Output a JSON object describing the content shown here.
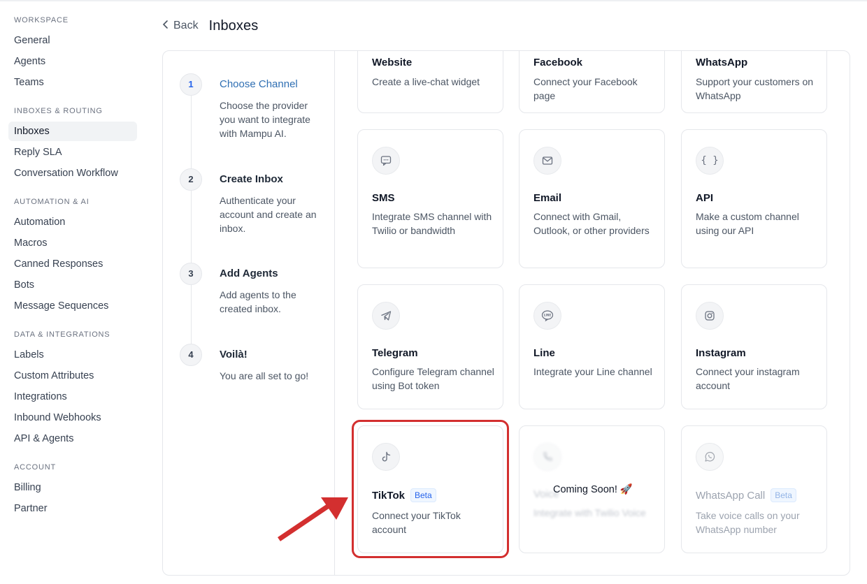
{
  "sidebar": {
    "sections": [
      {
        "title": "WORKSPACE",
        "items": [
          "General",
          "Agents",
          "Teams"
        ]
      },
      {
        "title": "INBOXES & ROUTING",
        "items": [
          "Inboxes",
          "Reply SLA",
          "Conversation Workflow"
        ]
      },
      {
        "title": "AUTOMATION & AI",
        "items": [
          "Automation",
          "Macros",
          "Canned Responses",
          "Bots",
          "Message Sequences"
        ]
      },
      {
        "title": "DATA & INTEGRATIONS",
        "items": [
          "Labels",
          "Custom Attributes",
          "Integrations",
          "Inbound Webhooks",
          "API & Agents"
        ]
      },
      {
        "title": "ACCOUNT",
        "items": [
          "Billing",
          "Partner"
        ]
      }
    ],
    "active": "Inboxes"
  },
  "header": {
    "back_label": "Back",
    "title": "Inboxes"
  },
  "steps": [
    {
      "num": "1",
      "title": "Choose Channel",
      "desc": "Choose the provider you want to integrate with Mampu AI."
    },
    {
      "num": "2",
      "title": "Create Inbox",
      "desc": "Authenticate your account and create an inbox."
    },
    {
      "num": "3",
      "title": "Add Agents",
      "desc": "Add agents to the created inbox."
    },
    {
      "num": "4",
      "title": "Voilà!",
      "desc": "You are all set to go!"
    }
  ],
  "channels": {
    "website": {
      "name": "Website",
      "desc": "Create a live-chat widget",
      "icon": "globe-icon"
    },
    "facebook": {
      "name": "Facebook",
      "desc": "Connect your Facebook page",
      "icon": "facebook-icon"
    },
    "whatsapp": {
      "name": "WhatsApp",
      "desc": "Support your customers on WhatsApp",
      "icon": "whatsapp-icon"
    },
    "sms": {
      "name": "SMS",
      "desc": "Integrate SMS channel with Twilio or bandwidth",
      "icon": "chat-bubble-icon"
    },
    "email": {
      "name": "Email",
      "desc": "Connect with Gmail, Outlook, or other providers",
      "icon": "mail-icon"
    },
    "api": {
      "name": "API",
      "desc": "Make a custom channel using our API",
      "icon": "braces-icon"
    },
    "telegram": {
      "name": "Telegram",
      "desc": "Configure Telegram channel using Bot token",
      "icon": "paper-plane-icon"
    },
    "line": {
      "name": "Line",
      "desc": "Integrate your Line channel",
      "icon": "line-icon"
    },
    "instagram": {
      "name": "Instagram",
      "desc": "Connect your instagram account",
      "icon": "instagram-icon"
    },
    "tiktok": {
      "name": "TikTok",
      "badge": "Beta",
      "desc": "Connect your TikTok account",
      "icon": "tiktok-icon"
    },
    "voice": {
      "name": "Voice",
      "desc": "Integrate with Twilio Voice",
      "overlay": "Coming Soon! 🚀",
      "icon": "phone-icon"
    },
    "whatsapp_call": {
      "name": "WhatsApp Call",
      "badge": "Beta",
      "desc": "Take voice calls on your WhatsApp number",
      "icon": "whatsapp-icon"
    }
  },
  "colors": {
    "accent": "#2f6fb3",
    "highlight": "#d32f2f",
    "badge_text": "#2563eb"
  }
}
